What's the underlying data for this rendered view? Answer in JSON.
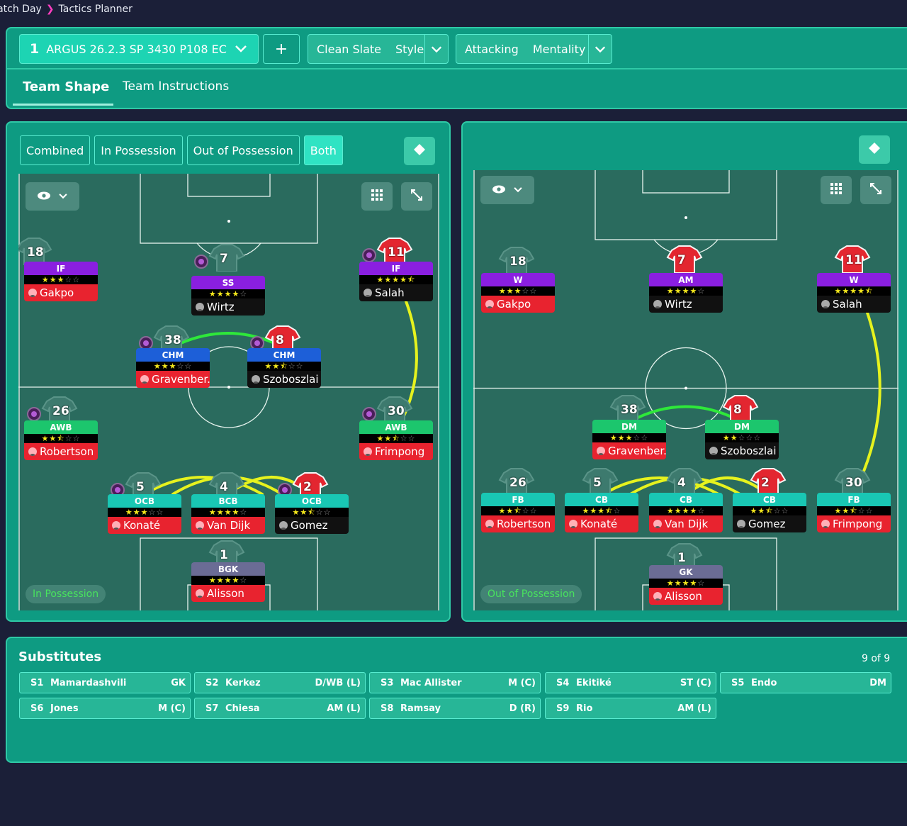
{
  "breadcrumb": {
    "part1": "Match Day",
    "part2": "Tactics Planner"
  },
  "header": {
    "tactic_number": "1",
    "tactic_name": "ARGUS 26.2.3 SP 3430 P108 EC",
    "add_label": "+",
    "style": {
      "value": "Clean Slate",
      "label": "Style"
    },
    "mentality": {
      "value": "Attacking",
      "label": "Mentality"
    },
    "tabs": [
      {
        "label": "Team Shape"
      },
      {
        "label": "Team Instructions"
      }
    ]
  },
  "view_buttons": [
    "Combined",
    "In Possession",
    "Out of Possession",
    "Both"
  ],
  "left_pitch": {
    "phase": "In Possession",
    "players": [
      {
        "num": "18",
        "role": "IF",
        "stars": 3,
        "name": "Gakpo"
      },
      {
        "num": "7",
        "role": "SS",
        "stars": 4,
        "name": "Wirtz"
      },
      {
        "num": "11",
        "role": "IF",
        "stars": 4.5,
        "name": "Salah"
      },
      {
        "num": "38",
        "role": "CHM",
        "stars": 3,
        "name": "Gravenber..."
      },
      {
        "num": "8",
        "role": "CHM",
        "stars": 2.5,
        "name": "Szoboszlai"
      },
      {
        "num": "26",
        "role": "AWB",
        "stars": 2.5,
        "name": "Robertson"
      },
      {
        "num": "30",
        "role": "AWB",
        "stars": 2.5,
        "name": "Frimpong"
      },
      {
        "num": "5",
        "role": "OCB",
        "stars": 3,
        "name": "Konaté"
      },
      {
        "num": "4",
        "role": "BCB",
        "stars": 4,
        "name": "Van Dijk"
      },
      {
        "num": "2",
        "role": "OCB",
        "stars": 2.5,
        "name": "Gomez"
      },
      {
        "num": "1",
        "role": "BGK",
        "stars": 4,
        "name": "Alisson"
      }
    ]
  },
  "right_pitch": {
    "phase": "Out of Possession",
    "players": [
      {
        "num": "18",
        "role": "W",
        "stars": 3,
        "name": "Gakpo"
      },
      {
        "num": "7",
        "role": "AM",
        "stars": 4,
        "name": "Wirtz"
      },
      {
        "num": "11",
        "role": "W",
        "stars": 4.5,
        "name": "Salah"
      },
      {
        "num": "38",
        "role": "DM",
        "stars": 3,
        "name": "Gravenber..."
      },
      {
        "num": "8",
        "role": "DM",
        "stars": 2,
        "name": "Szoboszlai"
      },
      {
        "num": "26",
        "role": "FB",
        "stars": 2.5,
        "name": "Robertson"
      },
      {
        "num": "5",
        "role": "CB",
        "stars": 3.5,
        "name": "Konaté"
      },
      {
        "num": "4",
        "role": "CB",
        "stars": 4,
        "name": "Van Dijk"
      },
      {
        "num": "2",
        "role": "CB",
        "stars": 2.5,
        "name": "Gomez"
      },
      {
        "num": "30",
        "role": "FB",
        "stars": 2.5,
        "name": "Frimpong"
      },
      {
        "num": "1",
        "role": "GK",
        "stars": 4,
        "name": "Alisson"
      }
    ]
  },
  "substitutes": {
    "title": "Substitutes",
    "count": "9 of 9",
    "items": [
      {
        "code": "S1",
        "name": "Mamardashvili",
        "pos": "GK"
      },
      {
        "code": "S2",
        "name": "Kerkez",
        "pos": "D/WB (L)"
      },
      {
        "code": "S3",
        "name": "Mac Allister",
        "pos": "M (C)"
      },
      {
        "code": "S4",
        "name": "Ekitiké",
        "pos": "ST (C)"
      },
      {
        "code": "S5",
        "name": "Endo",
        "pos": "DM"
      },
      {
        "code": "S6",
        "name": "Jones",
        "pos": "M (C)"
      },
      {
        "code": "S7",
        "name": "Chiesa",
        "pos": "AM (L)"
      },
      {
        "code": "S8",
        "name": "Ramsay",
        "pos": "D (R)"
      },
      {
        "code": "S9",
        "name": "Rio",
        "pos": "AM (L)"
      }
    ]
  }
}
